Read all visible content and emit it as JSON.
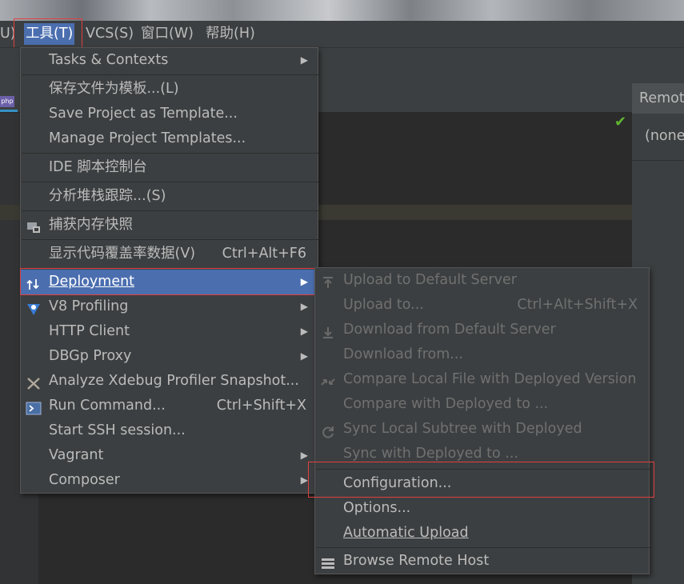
{
  "menubar": {
    "cut_item": "U)",
    "tools": "工具(T)",
    "vcs": "VCS(S)",
    "window": "窗口(W)",
    "help": "帮助(H)"
  },
  "tab": {
    "php_badge": "php"
  },
  "right_panel": {
    "header": "Remot",
    "value": "(none"
  },
  "tools_menu": {
    "tasks": "Tasks & Contexts",
    "save_template_cn": "保存文件为模板...(L)",
    "save_project_template": "Save Project as Template...",
    "manage_templates": "Manage Project Templates...",
    "ide_console": "IDE 脚本控制台",
    "analyze_stack": "分析堆栈跟踪...(S)",
    "capture_memory": "捕获内存快照",
    "show_coverage": "显示代码覆盖率数据(V)",
    "show_coverage_shortcut": "Ctrl+Alt+F6",
    "deployment": "Deployment",
    "v8": "V8 Profiling",
    "http": "HTTP Client",
    "dbgp": "DBGp Proxy",
    "xdebug": "Analyze Xdebug Profiler Snapshot...",
    "run_command": "Run Command...",
    "run_command_shortcut": "Ctrl+Shift+X",
    "ssh": "Start SSH session...",
    "vagrant": "Vagrant",
    "composer": "Composer"
  },
  "deployment_menu": {
    "upload_default": "Upload to Default Server",
    "upload_to": "Upload to...",
    "upload_to_shortcut": "Ctrl+Alt+Shift+X",
    "download_default": "Download from Default Server",
    "download_from": "Download from...",
    "compare_local": "Compare Local File with Deployed Version",
    "compare_deployed": "Compare with Deployed to ...",
    "sync_subtree": "Sync Local Subtree with Deployed",
    "sync_with": "Sync with Deployed to ...",
    "configuration": "Configuration...",
    "options": "Options...",
    "auto_upload": "Automatic Upload",
    "browse_remote": "Browse Remote Host"
  },
  "colors": {
    "accent": "#4b6eaf",
    "highlight_box": "#e0403f",
    "menu_bg": "#3c3f41"
  }
}
